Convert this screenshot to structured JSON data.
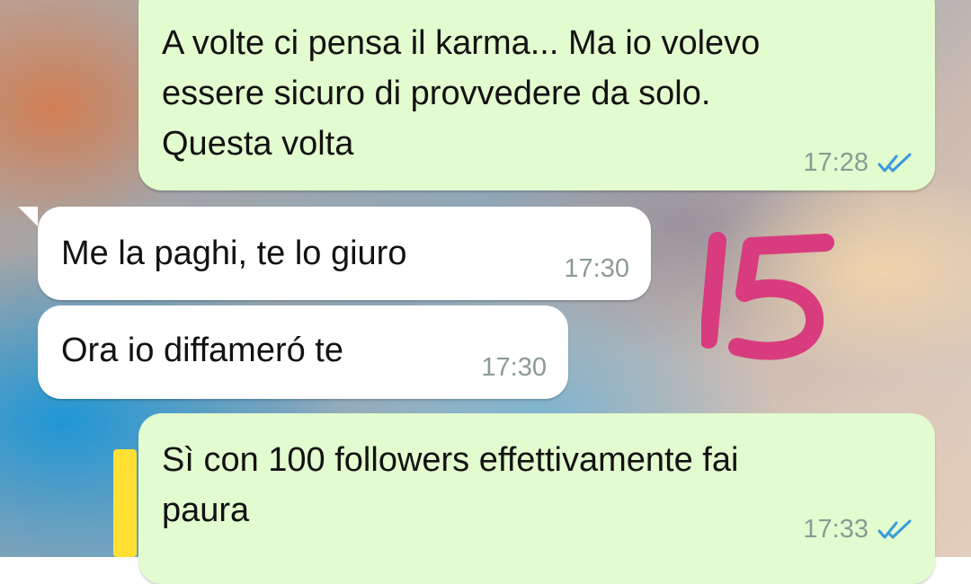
{
  "chat": {
    "messages": [
      {
        "direction": "outgoing",
        "text": "A volte ci pensa il karma... Ma io volevo\nessere sicuro di provvedere da solo.\nQuesta volta",
        "time": "17:28",
        "status": "read"
      },
      {
        "direction": "incoming",
        "text": "Me la paghi, te lo giuro",
        "time": "17:30"
      },
      {
        "direction": "incoming",
        "text": "Ora io diffameró te",
        "time": "17:30"
      },
      {
        "direction": "outgoing",
        "text": "Sì con 100 followers effettivamente fai\npaura",
        "time": "17:33",
        "status": "read"
      }
    ]
  },
  "overlay": {
    "sticker_text": "15",
    "sticker_color": "#d83c7e"
  },
  "colors": {
    "outgoing_bubble": "#e2fbcf",
    "incoming_bubble": "#ffffff",
    "read_ticks": "#3a9bdc",
    "quote_bar": "#ffe033"
  }
}
